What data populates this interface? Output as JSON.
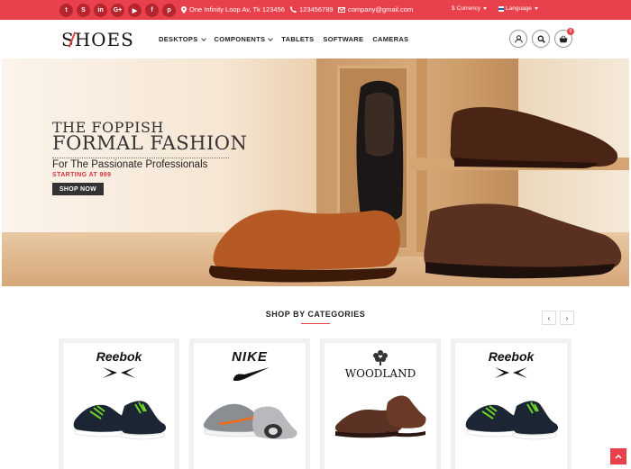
{
  "topbar": {
    "social_icons": [
      {
        "name": "twitter-icon",
        "glyph": "t"
      },
      {
        "name": "skype-icon",
        "glyph": "S"
      },
      {
        "name": "linkedin-icon",
        "glyph": "in"
      },
      {
        "name": "google-plus-icon",
        "glyph": "G+"
      },
      {
        "name": "youtube-icon",
        "glyph": "▶"
      },
      {
        "name": "facebook-icon",
        "glyph": "f"
      },
      {
        "name": "pinterest-icon",
        "glyph": "p"
      }
    ],
    "address": "One Infinity Loop Av, Tk 123456",
    "phone": "123456789",
    "email": "company@gmail.com",
    "currency_label": "Currency",
    "language_label": "Language"
  },
  "header": {
    "logo_text": "SHOES",
    "nav": [
      {
        "label": "DESKTOPS",
        "dropdown": true
      },
      {
        "label": "COMPONENTS",
        "dropdown": true
      },
      {
        "label": "TABLETS",
        "dropdown": false
      },
      {
        "label": "SOFTWARE",
        "dropdown": false
      },
      {
        "label": "CAMERAS",
        "dropdown": false
      }
    ],
    "cart_count": "0"
  },
  "hero": {
    "line1": "THE FOPPISH",
    "line2": "FORMAL FASHION",
    "line3": "For The Passionate Professionals",
    "price_line": "STARTING AT 999",
    "button": "SHOP NOW"
  },
  "categories": {
    "title": "SHOP BY CATEGORIES",
    "prev": "‹",
    "next": "›",
    "items": [
      {
        "brand": "Reebok",
        "style": "reebok"
      },
      {
        "brand": "NIKE",
        "style": "nike"
      },
      {
        "brand": "WOODLAND",
        "style": "woodland"
      },
      {
        "brand": "Reebok",
        "style": "reebok"
      }
    ]
  },
  "colors": {
    "accent": "#e8414c",
    "dark": "#333333"
  }
}
